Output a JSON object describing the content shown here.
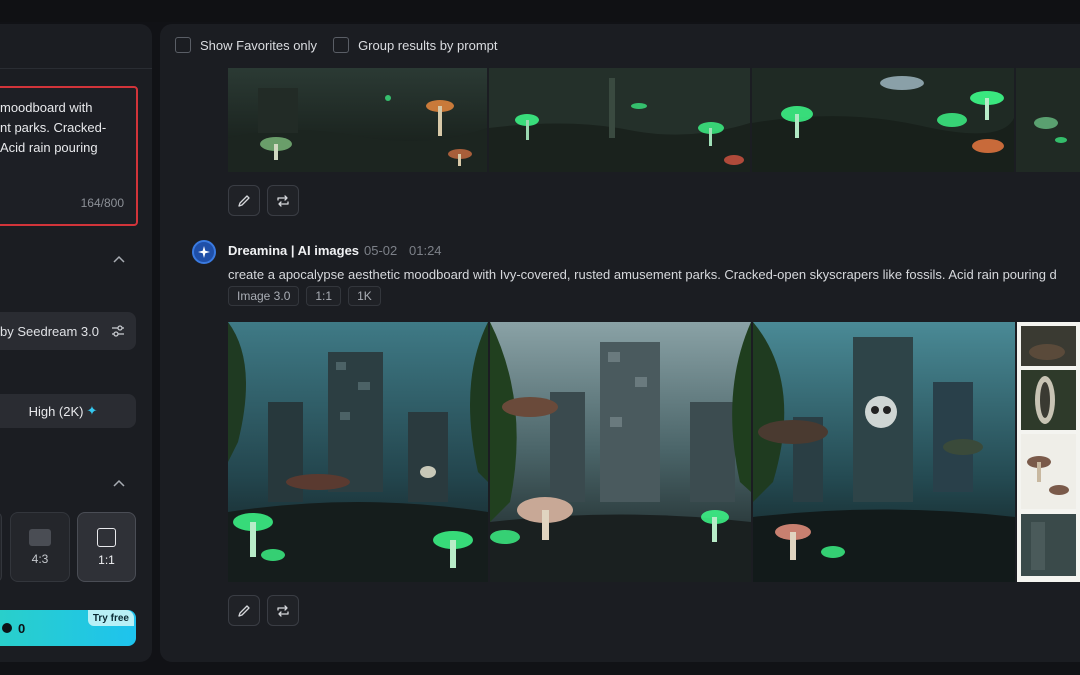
{
  "left_panel": {
    "prompt_text": "moodboard with\nnt parks. Cracked-\nAcid rain pouring",
    "char_count": "164/800",
    "model_label": "by Seedream 3.0",
    "quality_label": "High (2K)",
    "ratios": [
      {
        "label": "4:3"
      },
      {
        "label": "1:1",
        "active": true
      }
    ],
    "generate_cost": "0",
    "try_free_label": "Try free"
  },
  "main": {
    "filters": {
      "show_favorites": "Show Favorites only",
      "group_by_prompt": "Group results by prompt"
    },
    "message": {
      "author": "Dreamina | AI images",
      "date": "05-02",
      "time": "01:24",
      "prompt": "create a apocalypse aesthetic moodboard with Ivy-covered, rusted amusement parks. Cracked-open skyscrapers like fossils. Acid rain pouring d",
      "tags": [
        "Image 3.0",
        "1:1",
        "1K"
      ]
    }
  },
  "colors": {
    "accent_cyan": "#1ec3ee",
    "highlight_red": "#d2343a",
    "mushroom_glow": "#3dfc8a"
  }
}
